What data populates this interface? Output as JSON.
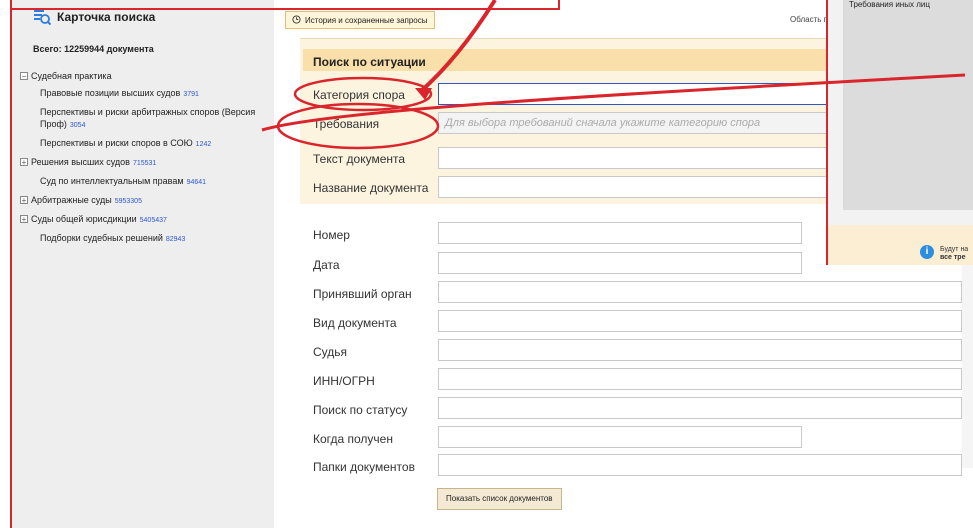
{
  "sidebar": {
    "title": "Карточка поиска",
    "total": "Всего: 12259944 документа",
    "tree": [
      {
        "label": "Судебная практика",
        "count": "",
        "level": 0,
        "toggle": "−"
      },
      {
        "label": "Правовые позиции высших судов",
        "count": "3791",
        "level": 2,
        "toggle": ""
      },
      {
        "label": "Перспективы и риски арбитражных споров (Версия Проф)",
        "count": "3054",
        "level": 2,
        "toggle": ""
      },
      {
        "label": "Перспективы и риски споров в СОЮ",
        "count": "1242",
        "level": 2,
        "toggle": ""
      },
      {
        "label": "Решения высших судов",
        "count": "715531",
        "level": 1,
        "toggle": "+"
      },
      {
        "label": "Суд по интеллектуальным правам",
        "count": "94641",
        "level": 2,
        "toggle": ""
      },
      {
        "label": "Арбитражные суды",
        "count": "5953305",
        "level": 1,
        "toggle": "+"
      },
      {
        "label": "Суды общей юрисдикции",
        "count": "5405437",
        "level": 1,
        "toggle": "+"
      },
      {
        "label": "Подборки судебных решений",
        "count": "82943",
        "level": 2,
        "toggle": ""
      }
    ]
  },
  "header": {
    "history_button": "История и сохраненные запросы",
    "area_label": "Область п"
  },
  "situation": {
    "title": "Поиск по ситуации",
    "dispute_category_label": "Категория спора",
    "requirements_label": "Требования",
    "requirements_placeholder": "Для выбора требований сначала укажите категорию спора",
    "doc_text_label": "Текст документа",
    "doc_name_label": "Название документа"
  },
  "fields": {
    "number": "Номер",
    "date": "Дата",
    "authority": "Принявший орган",
    "doc_type": "Вид документа",
    "judge": "Судья",
    "inn": "ИНН/ОГРН",
    "status": "Поиск по статусу",
    "received": "Когда получен",
    "folders": "Папки документов"
  },
  "show_button": "Показать список документов",
  "right_panel": {
    "heading": "Требования иных лиц",
    "note_line1": "Будут на",
    "note_line2": "все тре"
  },
  "colors": {
    "annotation_red": "#d9252b",
    "count_blue": "#2b58d6",
    "header_bg": "#f9dfa9"
  }
}
